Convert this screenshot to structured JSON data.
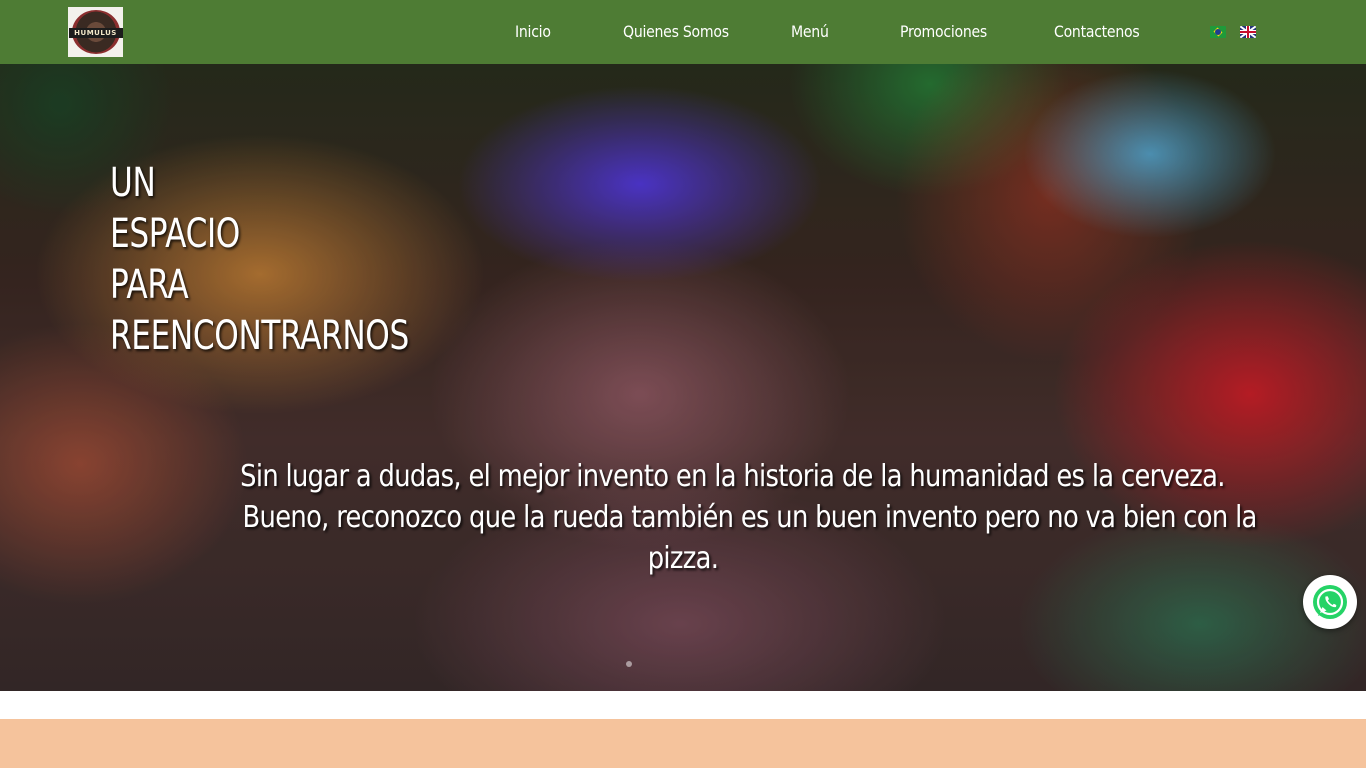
{
  "header": {
    "logo_text": "HUMULUS",
    "nav": [
      "Inicio",
      "Quienes Somos",
      "Menú",
      "Promociones",
      "Contactenos"
    ],
    "languages": [
      "Português",
      "English"
    ]
  },
  "hero": {
    "heading_lines": [
      "UN",
      "ESPACIO",
      "PARA",
      "REENCONTRARNOS"
    ],
    "quote_lines": [
      "Sin lugar a dudas, el mejor invento en la historia de la humanidad es la cerveza.",
      "Bueno, reconozco que la rueda también es un buen invento pero no va bien con la",
      "pizza."
    ]
  },
  "section": {
    "title": ""
  },
  "colors": {
    "header_bg": "#4e7c34",
    "section_bg": "#f5c39c",
    "whatsapp": "#25d366"
  },
  "icons": [
    "whatsapp-icon",
    "brazil-flag-icon",
    "uk-flag-icon"
  ]
}
